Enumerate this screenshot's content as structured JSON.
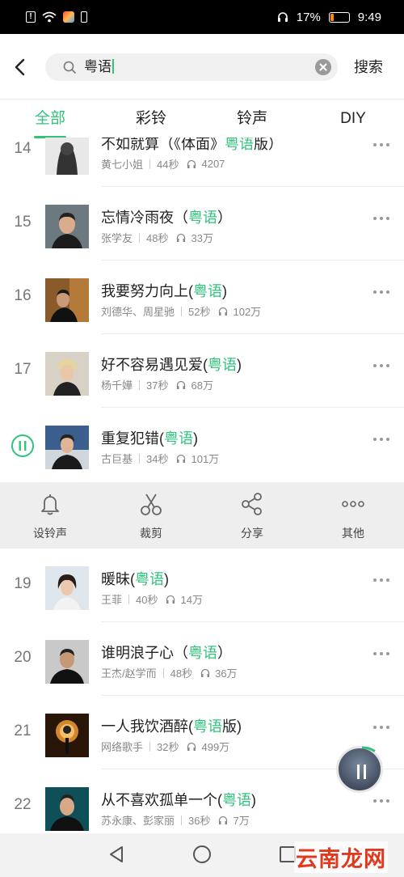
{
  "status_bar": {
    "battery": "17%",
    "time": "9:49",
    "icons": [
      "alert-icon",
      "wifi-icon",
      "app-icon",
      "sim-icon",
      "headset-icon",
      "battery-icon"
    ]
  },
  "header": {
    "back_icon": "back-arrow-icon",
    "search_query": "粤语",
    "search_button": "搜索"
  },
  "tabs": [
    {
      "label": "全部",
      "active": true
    },
    {
      "label": "彩铃",
      "active": false
    },
    {
      "label": "铃声",
      "active": false
    },
    {
      "label": "DIY",
      "active": false
    }
  ],
  "songs": [
    {
      "num": "14",
      "title_pre": "不如就算（《体面》",
      "title_hl": "粤语",
      "title_post": "版）",
      "artist": "黄七小姐",
      "duration": "44秒",
      "plays": "4207"
    },
    {
      "num": "15",
      "title_pre": "忘情冷雨夜（",
      "title_hl": "粤语",
      "title_post": "）",
      "artist": "张学友",
      "duration": "48秒",
      "plays": "33万"
    },
    {
      "num": "16",
      "title_pre": "我要努力向上(",
      "title_hl": "粤语",
      "title_post": ")",
      "artist": "刘德华、周星驰",
      "duration": "52秒",
      "plays": "102万"
    },
    {
      "num": "17",
      "title_pre": "好不容易遇见爱(",
      "title_hl": "粤语",
      "title_post": ")",
      "artist": "杨千嬅",
      "duration": "37秒",
      "plays": "68万"
    },
    {
      "num": "",
      "title_pre": "重复犯错(",
      "title_hl": "粤语",
      "title_post": ")",
      "artist": "古巨基",
      "duration": "34秒",
      "plays": "101万",
      "playing": true
    },
    {
      "num": "19",
      "title_pre": "暖昧(",
      "title_hl": "粤语",
      "title_post": ")",
      "artist": "王菲",
      "duration": "40秒",
      "plays": "14万"
    },
    {
      "num": "20",
      "title_pre": "谁明浪子心（",
      "title_hl": "粤语",
      "title_post": "）",
      "artist": "王杰/赵学而",
      "duration": "48秒",
      "plays": "36万"
    },
    {
      "num": "21",
      "title_pre": "一人我饮酒醉(",
      "title_hl": "粤语",
      "title_post": "版)",
      "artist": "网络歌手",
      "duration": "32秒",
      "plays": "499万"
    },
    {
      "num": "22",
      "title_pre": "从不喜欢孤单一个(",
      "title_hl": "粤语",
      "title_post": ")",
      "artist": "苏永康、彭家丽",
      "duration": "36秒",
      "plays": "7万"
    }
  ],
  "actions": [
    {
      "label": "设铃声",
      "icon": "bell-icon"
    },
    {
      "label": "裁剪",
      "icon": "scissors-icon"
    },
    {
      "label": "分享",
      "icon": "share-icon"
    },
    {
      "label": "其他",
      "icon": "more-icon"
    }
  ],
  "watermark": "云南龙网",
  "accent_color": "#31c27c"
}
